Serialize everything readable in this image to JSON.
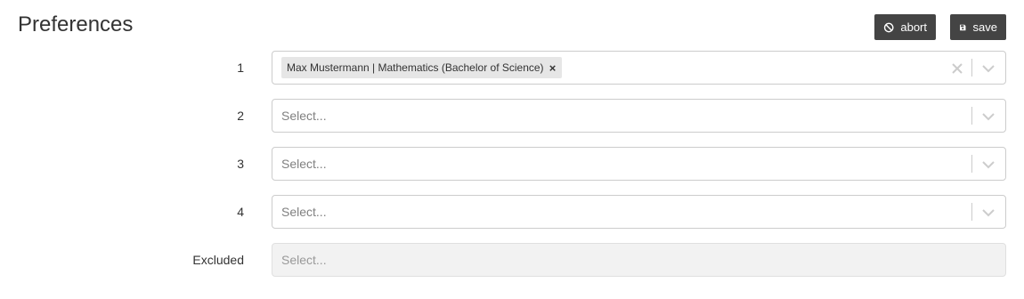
{
  "page": {
    "title": "Preferences"
  },
  "toolbar": {
    "abort_label": "abort",
    "save_label": "save"
  },
  "rows": [
    {
      "label": "1",
      "selected": "Max Mustermann | Mathematics (Bachelor of Science)",
      "placeholder": ""
    },
    {
      "label": "2",
      "placeholder": "Select..."
    },
    {
      "label": "3",
      "placeholder": "Select..."
    },
    {
      "label": "4",
      "placeholder": "Select..."
    }
  ],
  "excluded": {
    "label": "Excluded",
    "placeholder": "Select..."
  },
  "icons": {
    "abort": "ban-icon",
    "save": "floppy-disk-icon",
    "dropdown": "chevron-down-icon",
    "clear": "clear-icon",
    "remove": "remove-chip-icon"
  },
  "chip_remove_glyph": "×"
}
